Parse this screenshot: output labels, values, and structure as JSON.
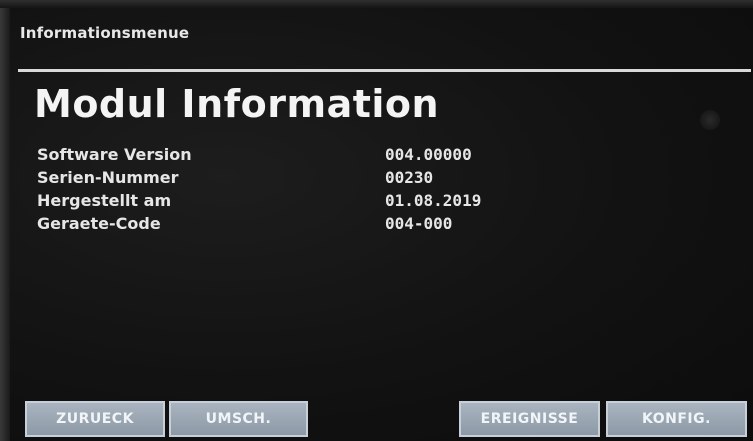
{
  "header": {
    "title": "Informationsmenue"
  },
  "page": {
    "title": "Modul Information"
  },
  "info": {
    "rows": [
      {
        "label": "Software Version",
        "value": "004.00000"
      },
      {
        "label": "Serien-Nummer",
        "value": "00230"
      },
      {
        "label": "Hergestellt am",
        "value": "01.08.2019"
      },
      {
        "label": "Geraete-Code",
        "value": "004-000"
      }
    ]
  },
  "buttons": {
    "back_label": "ZURUECK",
    "switch_label": "UMSCH.",
    "events_label": "EREIGNISSE",
    "config_label": "KONFIG."
  },
  "colors": {
    "background": "#121212",
    "text": "#f2f2f2",
    "button": "#9aa5b1"
  }
}
